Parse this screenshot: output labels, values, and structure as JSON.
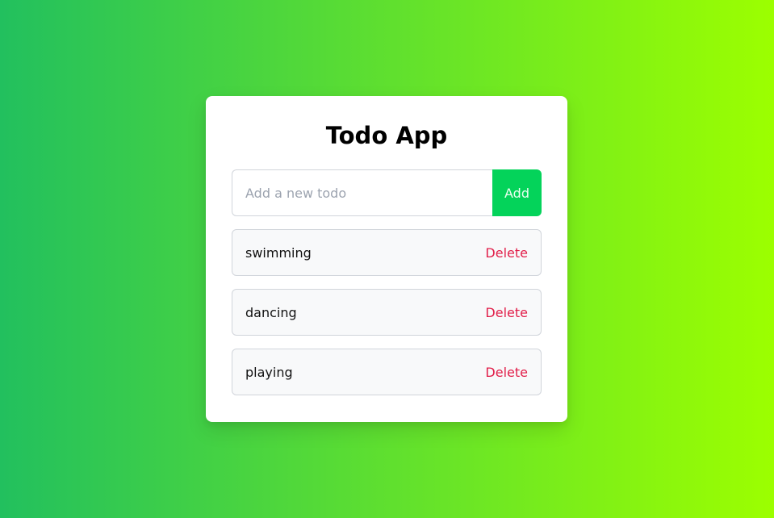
{
  "app": {
    "title": "Todo App"
  },
  "input": {
    "placeholder": "Add a new todo",
    "value": ""
  },
  "add_button": {
    "label": "Add"
  },
  "todos": [
    {
      "text": "swimming",
      "delete_label": "Delete"
    },
    {
      "text": "dancing",
      "delete_label": "Delete"
    },
    {
      "text": "playing",
      "delete_label": "Delete"
    }
  ],
  "colors": {
    "background_start": "#22c05e",
    "background_end": "#9cff00",
    "accent": "#04d35a",
    "delete": "#e11d48"
  }
}
